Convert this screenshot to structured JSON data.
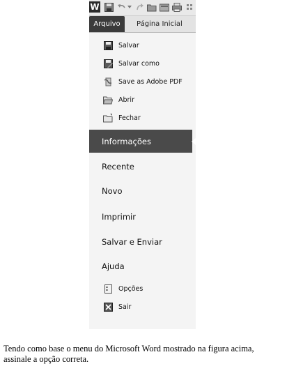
{
  "quick_access": {
    "app_icon": "word-logo-icon",
    "app_letter": "W",
    "buttons": [
      "save-icon",
      "undo-icon",
      "redo-icon",
      "open-folder-icon",
      "new-doc-icon",
      "print-icon"
    ]
  },
  "tabs": {
    "file_label": "Arquivo",
    "home_label": "Página Inicial"
  },
  "menu": {
    "commands": [
      {
        "label": "Salvar",
        "icon": "save-icon"
      },
      {
        "label": "Salvar como",
        "icon": "save-as-icon"
      },
      {
        "label": "Save as Adobe PDF",
        "icon": "pdf-icon"
      },
      {
        "label": "Abrir",
        "icon": "open-folder-icon"
      },
      {
        "label": "Fechar",
        "icon": "close-folder-icon"
      }
    ],
    "selected_label": "Informações",
    "items": [
      {
        "label": "Recente"
      },
      {
        "label": "Novo"
      },
      {
        "label": "Imprimir"
      },
      {
        "label": "Salvar e Enviar"
      },
      {
        "label": "Ajuda"
      }
    ],
    "footer": [
      {
        "label": "Opções",
        "icon": "options-icon"
      },
      {
        "label": "Sair",
        "icon": "exit-icon"
      }
    ]
  },
  "question": "Tendo como base o menu do Microsoft Word mostrado na figura acima, assinale a opção correta."
}
